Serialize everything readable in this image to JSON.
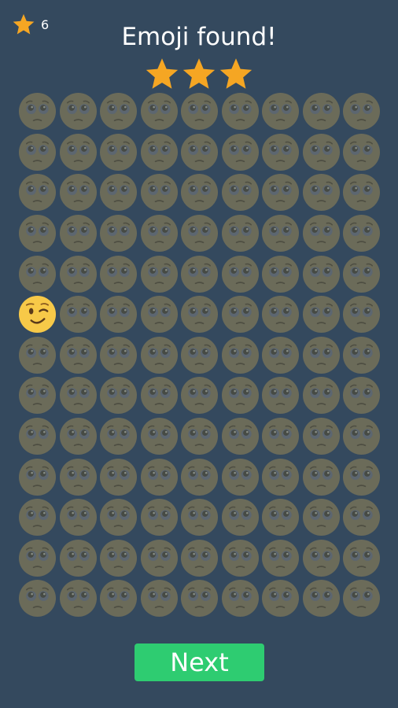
{
  "header": {
    "score_value": "6",
    "title": "Emoji found!"
  },
  "rating": {
    "stars_earned": 3,
    "stars_total": 3
  },
  "grid": {
    "rows": 13,
    "cols": 9,
    "background_emoji": "pleading-face-icon",
    "found_emoji": "winking-face-icon",
    "found_position": {
      "row": 5,
      "col": 1
    }
  },
  "footer": {
    "next_label": "Next"
  },
  "colors": {
    "background": "#34495e",
    "star": "#f5a623",
    "dimmed_emoji": "#6b6b59",
    "found_emoji": "#f7c948",
    "next_button": "#2ecc71",
    "text": "#ffffff"
  }
}
